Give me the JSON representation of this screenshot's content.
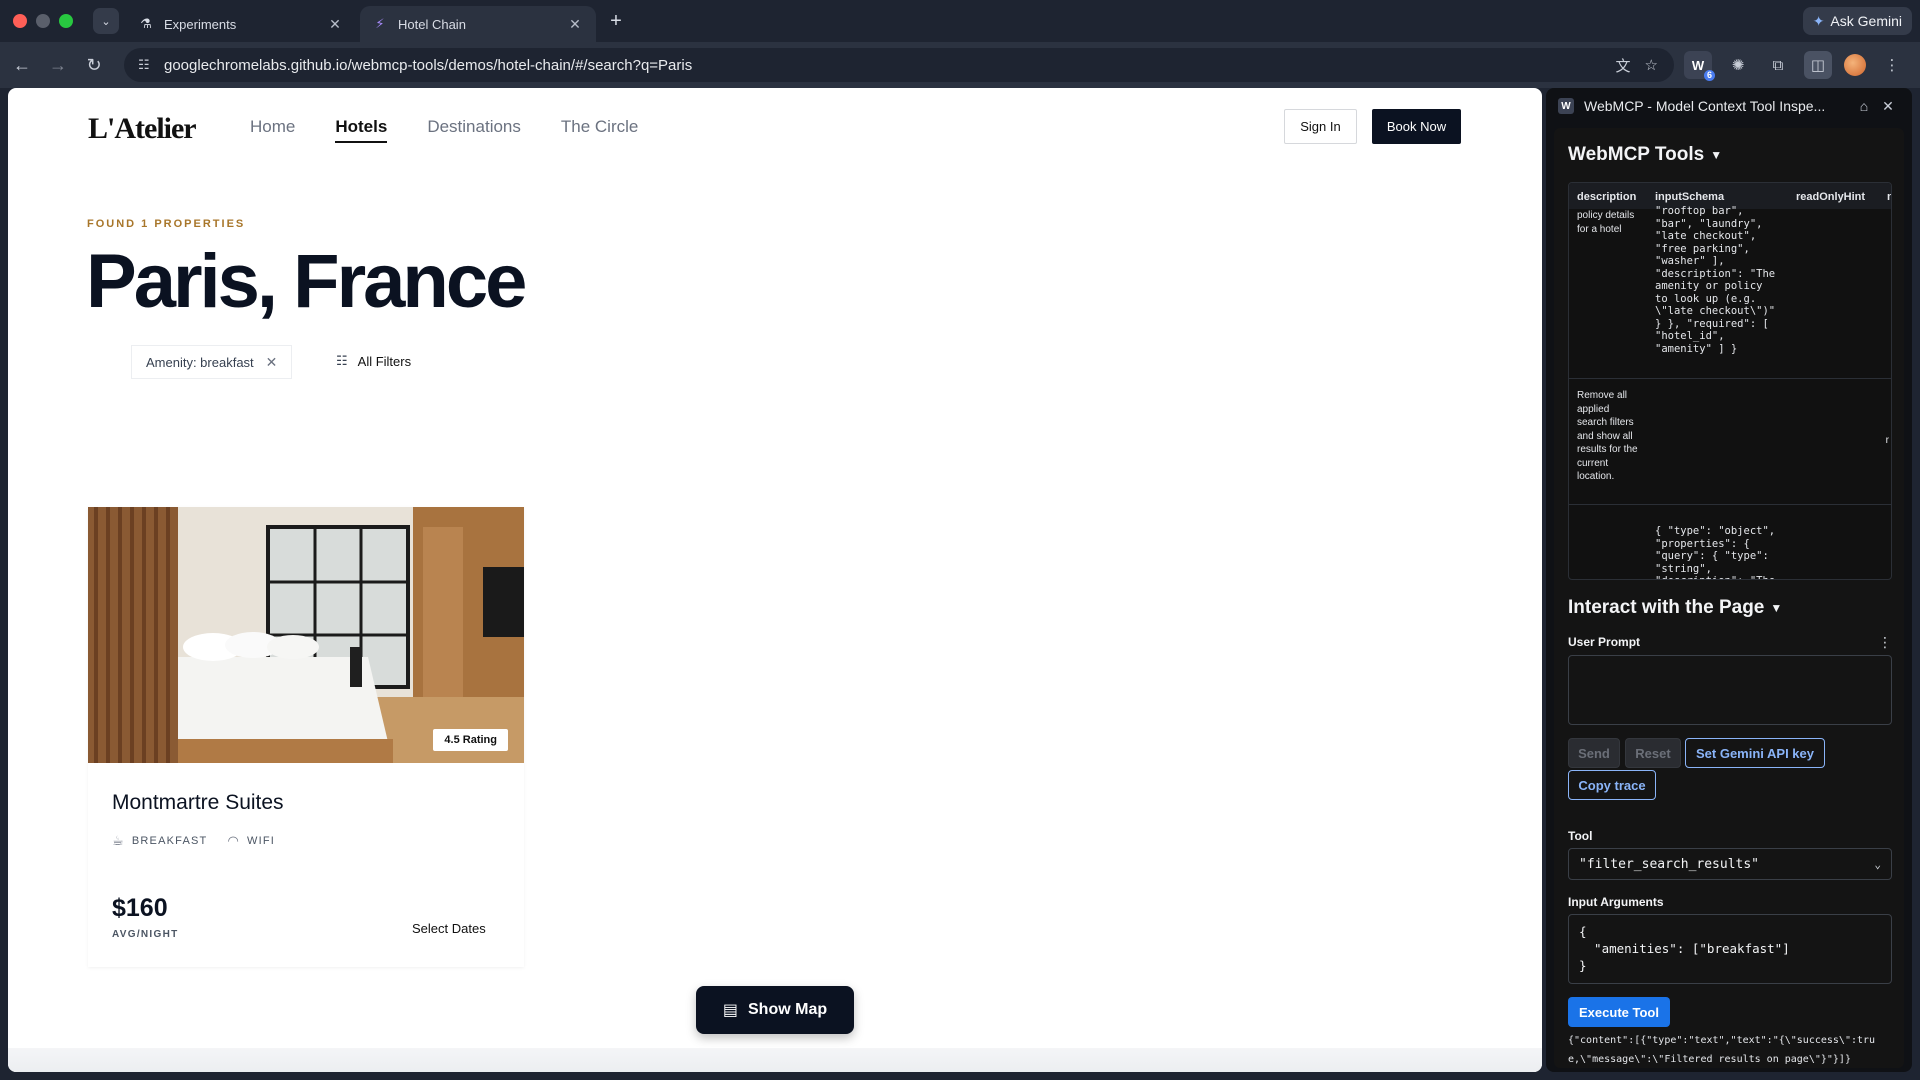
{
  "browser": {
    "tabs": [
      {
        "title": "Experiments",
        "icon": "flask-icon"
      },
      {
        "title": "Hotel Chain",
        "icon": "bolt-icon"
      }
    ],
    "ask_gemini": "Ask Gemini",
    "url": "googlechromelabs.github.io/webmcp-tools/demos/hotel-chain/#/search?q=Paris",
    "extension_badge": "6"
  },
  "site": {
    "logo": "L'Atelier",
    "nav": [
      "Home",
      "Hotels",
      "Destinations",
      "The Circle"
    ],
    "active_nav": "Hotels",
    "sign_in": "Sign In",
    "book_now": "Book Now"
  },
  "search": {
    "found_label": "FOUND 1 PROPERTIES",
    "title": "Paris, France",
    "filter_chip": "Amenity: breakfast",
    "all_filters": "All Filters"
  },
  "hotel": {
    "rating": "4.5 Rating",
    "name": "Montmartre Suites",
    "amenities": [
      "BREAKFAST",
      "WIFI"
    ],
    "price": "$160",
    "price_unit": "AVG/NIGHT",
    "select_dates": "Select Dates"
  },
  "show_map": "Show Map",
  "panel": {
    "title": "WebMCP - Model Context Tool Inspe...",
    "tools_title": "WebMCP Tools",
    "table_headers": [
      "description",
      "inputSchema",
      "readOnlyHint",
      "n"
    ],
    "rows": [
      {
        "description": "policy details for a hotel",
        "schema": "\"rooftop bar\",\n\"bar\", \"laundry\",\n\"late checkout\",\n\"free parking\",\n\"washer\" ],\n\"description\": \"The\namenity or policy\nto look up (e.g.\n\\\"late checkout\\\")\"\n} }, \"required\": [\n\"hotel_id\",\n\"amenity\" ] }",
        "extra": ""
      },
      {
        "description": "Remove all applied search filters and show all results for the current location.",
        "schema": "",
        "extra": "r"
      },
      {
        "description": "",
        "schema": "{ \"type\": \"object\",\n\"properties\": {\n\"query\": { \"type\":\n\"string\",\n\"description\": \"The",
        "extra": ""
      }
    ],
    "interact_title": "Interact with the Page",
    "user_prompt_label": "User Prompt",
    "send": "Send",
    "reset": "Reset",
    "set_key": "Set Gemini API key",
    "copy_trace": "Copy trace",
    "tool_label": "Tool",
    "tool_value": "\"filter_search_results\"",
    "args_label": "Input Arguments",
    "args_value": "{\n  \"amenities\": [\"breakfast\"]\n}",
    "execute": "Execute Tool",
    "result": "{\"content\":[{\"type\":\"text\",\"text\":\"{\\\"success\\\":true,\\\"message\\\":\\\"Filtered results on page\\\"}\"}]}"
  }
}
